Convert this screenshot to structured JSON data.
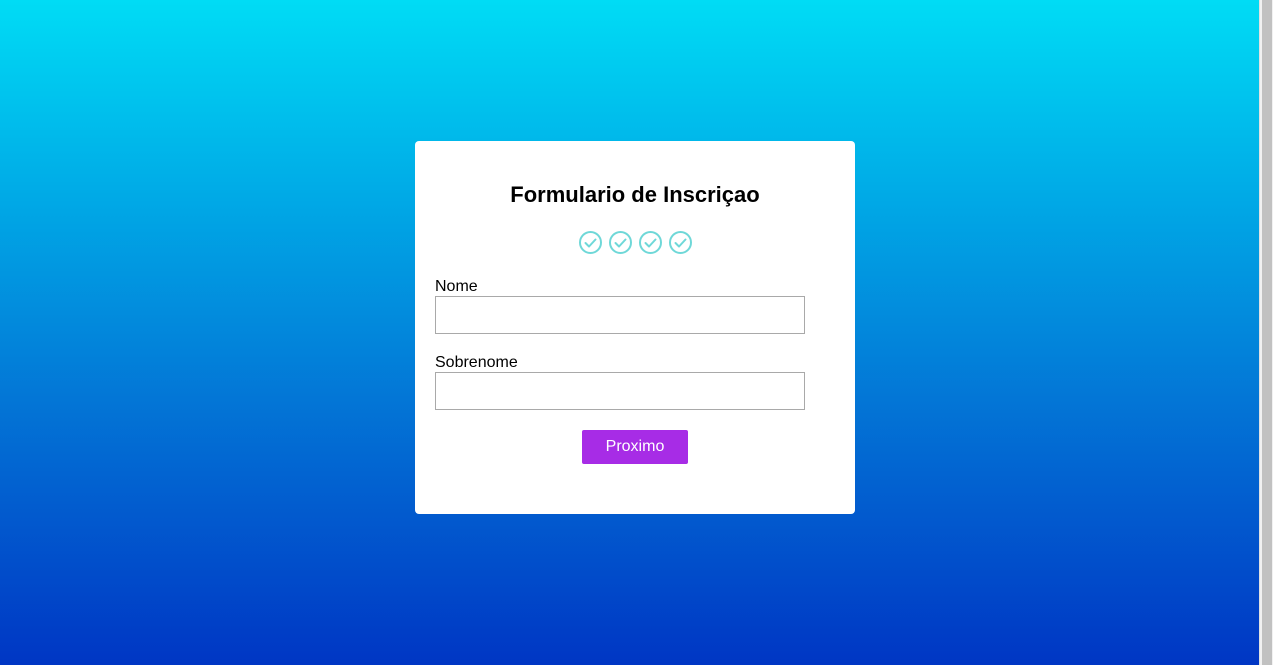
{
  "form": {
    "title": "Formulario de Inscriçao",
    "steps": [
      {
        "icon": "check-circle-icon",
        "state": "complete"
      },
      {
        "icon": "check-circle-icon",
        "state": "complete"
      },
      {
        "icon": "check-circle-icon",
        "state": "complete"
      },
      {
        "icon": "check-circle-icon",
        "state": "complete"
      }
    ],
    "fields": {
      "nome": {
        "label": "Nome",
        "value": "",
        "placeholder": ""
      },
      "sobrenome": {
        "label": "Sobrenome",
        "value": "",
        "placeholder": ""
      }
    },
    "next_button_label": "Proximo"
  },
  "colors": {
    "background_top": "#00dcf5",
    "background_bottom": "#0036c4",
    "card": "#ffffff",
    "step_icon": "#6fd8d8",
    "button": "#a72ce6",
    "button_text": "#ffffff"
  }
}
